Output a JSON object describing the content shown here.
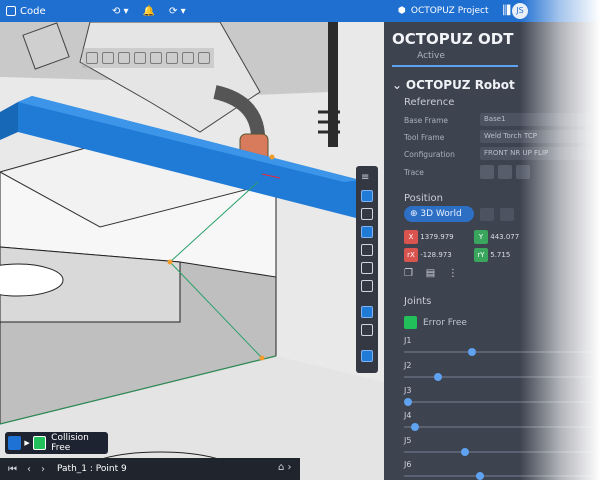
{
  "topbar": {
    "app_label": "Code",
    "project_label": "OCTOPUZ Project",
    "avatar_initials": "JS",
    "colors": {
      "accent": "#1f6fd1"
    }
  },
  "viewport": {
    "collision_status": "Collision Free",
    "path_label": "Path_1 : Point 9"
  },
  "panel": {
    "title": "OCTOPUZ ODT",
    "tab_active": "Active",
    "robot_heading": "OCTOPUZ Robot",
    "reference": {
      "heading": "Reference",
      "base_frame_label": "Base Frame",
      "base_frame_value": "Base1",
      "tool_frame_label": "Tool Frame",
      "tool_frame_value": "Weld Torch TCP",
      "configuration_label": "Configuration",
      "configuration_value": "FRONT NR UP FLIP",
      "trace_label": "Trace"
    },
    "position": {
      "heading": "Position",
      "world_pill": "3D World",
      "x_label": "X",
      "x_value": "1379.979",
      "y_label": "Y",
      "y_value": "443.077",
      "rx_label": "rX",
      "rx_value": "-128.973",
      "ry_label": "rY",
      "ry_value": "5.715"
    },
    "joints": {
      "heading": "Joints",
      "error_free": "Error Free",
      "items": [
        {
          "label": "J1",
          "value": 0.36
        },
        {
          "label": "J2",
          "value": 0.18
        },
        {
          "label": "J3",
          "value": 0.02
        },
        {
          "label": "J4",
          "value": 0.06
        },
        {
          "label": "J5",
          "value": 0.32
        },
        {
          "label": "J6",
          "value": 0.4
        }
      ]
    }
  }
}
